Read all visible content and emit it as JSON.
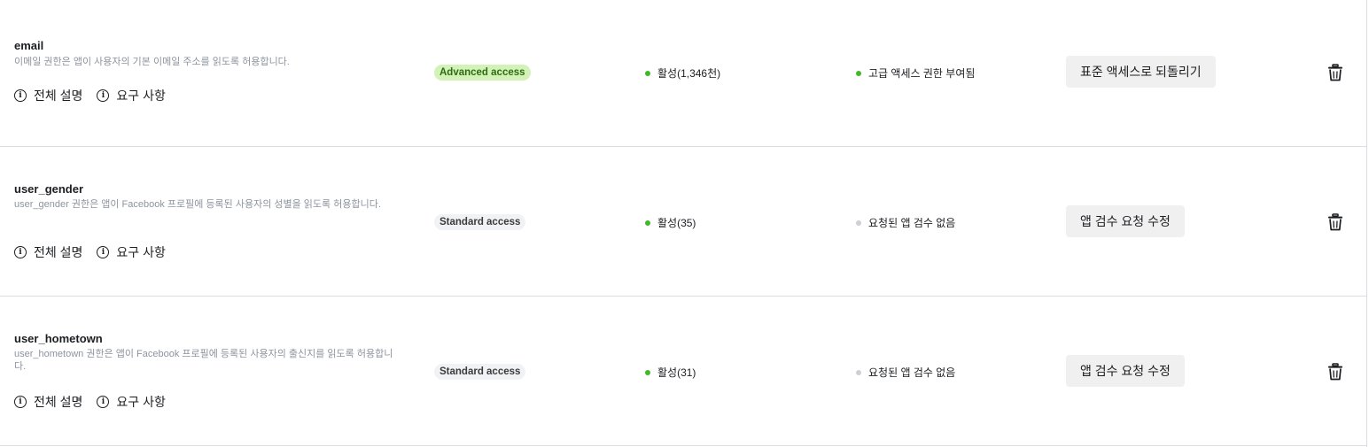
{
  "permissions": [
    {
      "name": "email",
      "description": "이메일 권한은 앱이 사용자의 기본 이메일 주소를 읽도록 허용합니다.",
      "link_full": "전체 설명",
      "link_req": "요구 사항",
      "access": "Advanced access",
      "access_level": "advanced",
      "status": "활성(1,346천)",
      "status_color": "#42b72a",
      "review": "고급 액세스 권한 부여됨",
      "review_color": "#42b72a",
      "action": "표준 액세스로 되돌리기",
      "delete_icon": "trash-icon"
    },
    {
      "name": "user_gender",
      "description": "user_gender 권한은 앱이 Facebook 프로필에 등록된 사용자의 성별을 읽도록 허용합니다.",
      "link_full": "전체 설명",
      "link_req": "요구 사항",
      "access": "Standard access",
      "access_level": "standard",
      "status": "활성(35)",
      "status_color": "#42b72a",
      "review": "요청된 앱 검수 없음",
      "review_color": "#ccd0d5",
      "action": "앱 검수 요청 수정",
      "delete_icon": "trash-icon"
    },
    {
      "name": "user_hometown",
      "description": "user_hometown 권한은 앱이 Facebook 프로필에 등록된 사용자의 출신지를 읽도록 허용합니다.",
      "link_full": "전체 설명",
      "link_req": "요구 사항",
      "access": "Standard access",
      "access_level": "standard",
      "status": "활성(31)",
      "status_color": "#42b72a",
      "review": "요청된 앱 검수 없음",
      "review_color": "#ccd0d5",
      "action": "앱 검수 요청 수정",
      "delete_icon": "trash-icon"
    }
  ],
  "colors": {
    "active_green": "#42b72a",
    "inactive_gray": "#ccd0d5",
    "advanced_badge_bg": "#d3f2b8",
    "standard_badge_bg": "#f0f2f5",
    "button_bg": "#f0f0f0"
  }
}
